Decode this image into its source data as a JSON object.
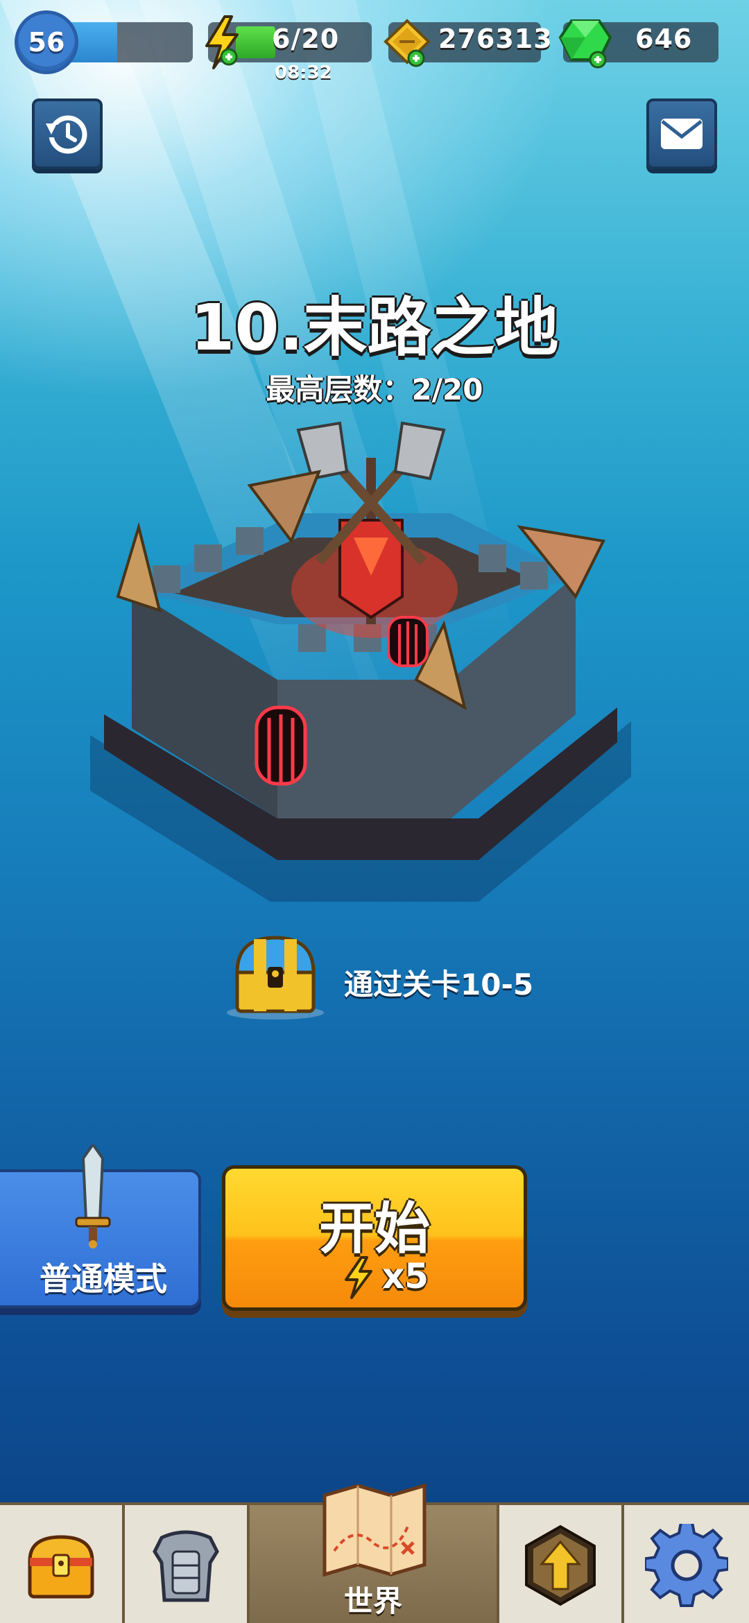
{
  "top_bar": {
    "level": "56",
    "xp_fraction": 0.45,
    "energy": "6/20",
    "energy_fraction": 0.3,
    "energy_timer": "08:32",
    "coins": "276313",
    "gems": "646"
  },
  "header_buttons": {
    "history_icon": "history-icon",
    "mail_icon": "mail-icon"
  },
  "stage": {
    "title": "10.末路之地",
    "best_floor": "最高层数：2/20"
  },
  "reward": {
    "text": "通过关卡10-5",
    "icon": "treasure-chest-icon"
  },
  "buttons": {
    "mode_label": "普通模式",
    "start_label": "开始",
    "cost_label": "x5"
  },
  "nav": {
    "items": [
      {
        "icon": "chest-icon",
        "label": ""
      },
      {
        "icon": "armor-icon",
        "label": ""
      },
      {
        "icon": "map-icon",
        "label": "世界"
      },
      {
        "icon": "upgrade-arrow-icon",
        "label": ""
      },
      {
        "icon": "gear-icon",
        "label": ""
      }
    ]
  },
  "colors": {
    "accent_yellow": "#ffc21c",
    "accent_blue": "#2f6fd4",
    "gem_green": "#2fd94a",
    "energy_green": "#3ecb35"
  }
}
